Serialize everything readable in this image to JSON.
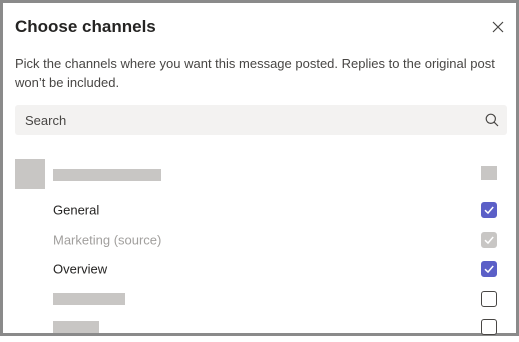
{
  "dialog": {
    "title": "Choose channels",
    "description": "Pick the channels where you want this message posted. Replies to the original post won’t be included."
  },
  "search": {
    "placeholder": "Search",
    "value": ""
  },
  "team": {
    "name": ""
  },
  "channels": [
    {
      "label": "General",
      "checked": true,
      "disabled": false
    },
    {
      "label": "Marketing (source)",
      "checked": true,
      "disabled": true
    },
    {
      "label": "Overview",
      "checked": true,
      "disabled": false
    },
    {
      "label": "",
      "checked": false,
      "disabled": false
    },
    {
      "label": "",
      "checked": false,
      "disabled": false
    }
  ],
  "icons": {
    "close": "close-icon",
    "search": "search-icon",
    "check": "checkmark-icon"
  },
  "colors": {
    "accent": "#5b5fc7",
    "disabled_check": "#c8c6c4",
    "placeholder_block": "#c8c6c4",
    "search_bg": "#f3f2f1"
  }
}
